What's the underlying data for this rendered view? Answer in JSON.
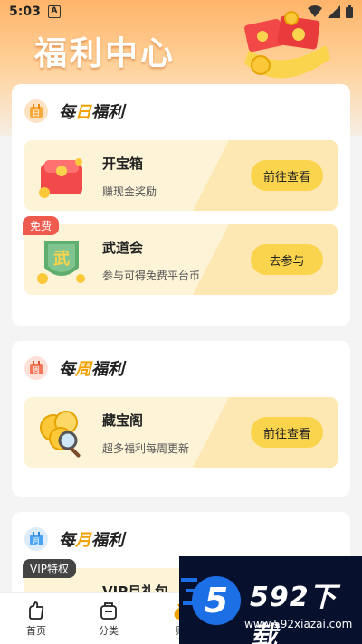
{
  "status_bar": {
    "time": "5:03",
    "notif_badge": "A"
  },
  "page_title": "福利中心",
  "sections": [
    {
      "title_pre": "每",
      "title_hl": "日",
      "title_post": "福利",
      "items": [
        {
          "name": "开宝箱",
          "desc": "赚现金奖励",
          "button": "前往查看"
        },
        {
          "name": "武道会",
          "desc": "参与可得免费平台币",
          "button": "去参与",
          "tag": "免费"
        }
      ]
    },
    {
      "title_pre": "每",
      "title_hl": "周",
      "title_post": "福利",
      "items": [
        {
          "name": "藏宝阁",
          "desc": "超多福利每周更新",
          "button": "前往查看"
        }
      ]
    },
    {
      "title_pre": "每",
      "title_hl": "月",
      "title_post": "福利",
      "items": [
        {
          "name": "VIP月礼包",
          "tag": "VIP特权"
        }
      ]
    }
  ],
  "bottom_nav": {
    "home": "首页",
    "category": "分类",
    "earn": "赚"
  },
  "watermark": {
    "brand": "592下载",
    "url": "www.592xiazai.com",
    "logo_digit": "5"
  },
  "icons": {
    "calendar_day": "日",
    "calendar_week": "周",
    "calendar_month": "月",
    "wu_badge": "武"
  },
  "colors": {
    "accent": "#fbd44e",
    "highlight": "#f1a200",
    "header": "#ffb46a"
  }
}
